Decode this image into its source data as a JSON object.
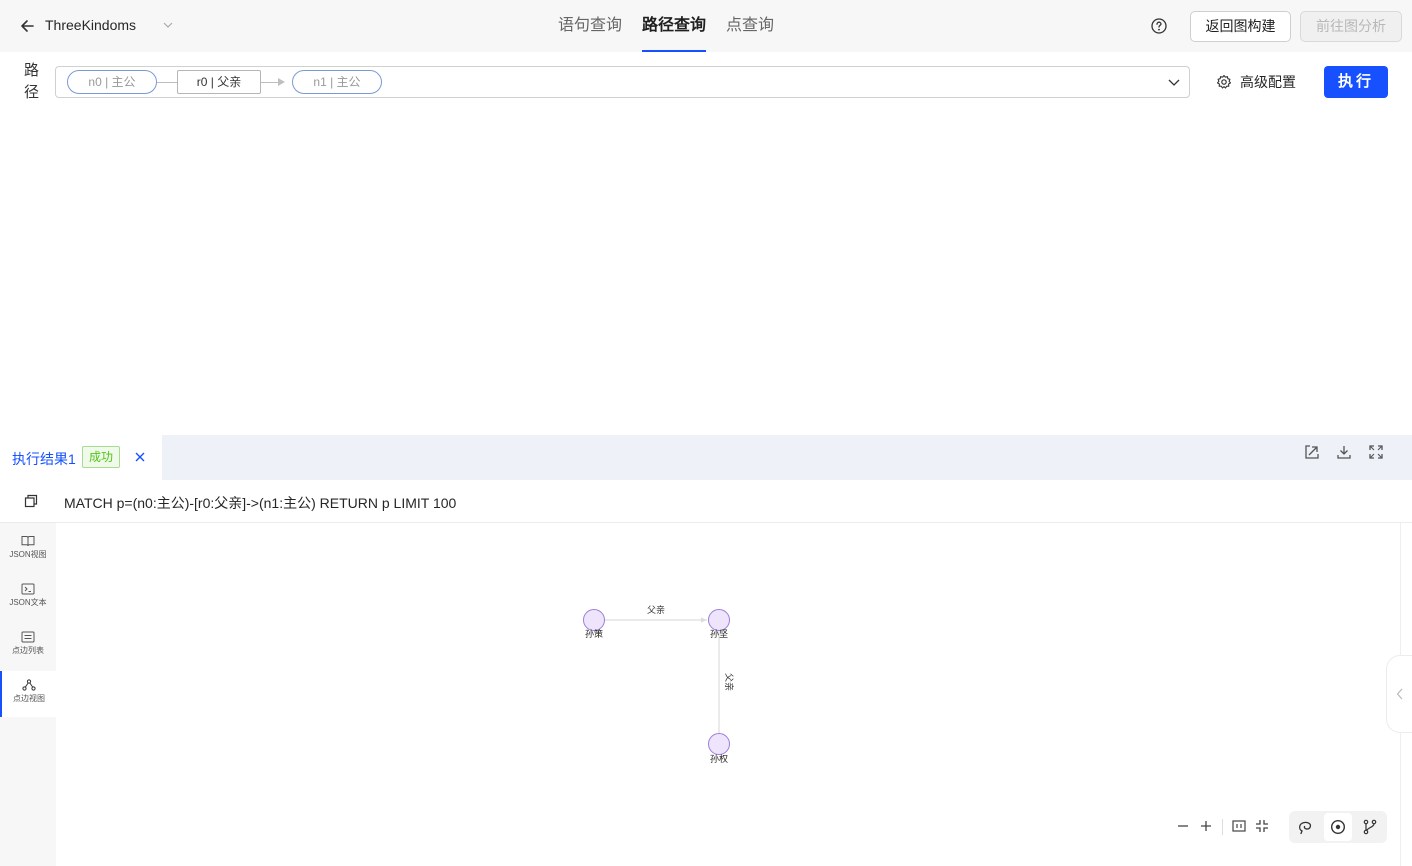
{
  "header": {
    "graph_name": "ThreeKindoms",
    "tabs": [
      {
        "label": "语句查询",
        "active": false
      },
      {
        "label": "路径查询",
        "active": true
      },
      {
        "label": "点查询",
        "active": false
      }
    ],
    "back_to_build_label": "返回图构建",
    "goto_analysis_label": "前往图分析",
    "goto_analysis_disabled": true
  },
  "path_query": {
    "label": "路径",
    "start_node": "n0 | 主公",
    "edge": "r0 | 父亲",
    "end_node": "n1 | 主公",
    "advanced_config_label": "高级配置",
    "run_label": "执行"
  },
  "result": {
    "tab_title": "执行结果1",
    "status": "成功",
    "query": "MATCH p=(n0:主公)-[r0:父亲]->(n1:主公) RETURN p LIMIT 100"
  },
  "views": [
    {
      "label": "JSON视图",
      "icon": "book-icon",
      "active": false
    },
    {
      "label": "JSON文本",
      "icon": "code-icon",
      "active": false
    },
    {
      "label": "点边列表",
      "icon": "list-icon",
      "active": false
    },
    {
      "label": "点边视图",
      "icon": "graph-icon",
      "active": true
    }
  ],
  "graph": {
    "nodes": [
      {
        "id": "sunjian",
        "label": "孙坚"
      },
      {
        "id": "suncefather",
        "label": "孙坚"
      },
      {
        "id": "sunquan",
        "label": "孙权"
      }
    ],
    "node_labels_rendered": [
      "孙策",
      "孙坚",
      "孙权"
    ],
    "edges": [
      {
        "label": "父亲"
      },
      {
        "label": "父亲"
      }
    ],
    "node_fill": "#eee4fb",
    "node_stroke": "#9b7ed8",
    "accent": "#1650ff"
  }
}
